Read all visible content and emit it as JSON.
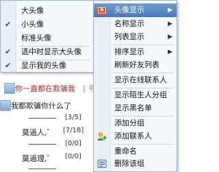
{
  "contacts": {
    "row1_text": "你一直都在欺骗我",
    "row1_suffix": "[ 号",
    "row2_text": "我都欺骗你什么了",
    "sub_rows": [
      {
        "name": "",
        "count": "[3/5]"
      },
      {
        "name": "莫過人,゛",
        "count": "[7/18]"
      },
      {
        "name": "",
        "count": "[0/0]"
      },
      {
        "name": "莫過理,゛",
        "count": "[0/0]"
      }
    ]
  },
  "submenu": {
    "items": [
      {
        "label": "大头像",
        "checked": false
      },
      {
        "label": "小头像",
        "checked": true
      },
      {
        "label": "标准头像",
        "checked": false
      },
      {
        "label": "选中时显示大头像",
        "checked": true
      },
      {
        "label": "显示我的头像",
        "checked": true
      }
    ],
    "check_glyph": "✔"
  },
  "mainmenu": {
    "items": [
      {
        "label": "头像显示",
        "submenu": true,
        "highlighted": true
      },
      {
        "label": "名称显示",
        "submenu": true
      },
      {
        "label": "列表显示",
        "submenu": true
      },
      {
        "label": "排序显示",
        "submenu": true
      },
      {
        "label": "刷新好友列表"
      },
      {
        "label": "显示在线联系人"
      },
      {
        "label": "显示陌生人分组"
      },
      {
        "label": "显示黑名单"
      },
      {
        "label": "添加分组"
      },
      {
        "label": "添加联系人"
      },
      {
        "label": "重命名"
      },
      {
        "label": "删除该组"
      }
    ],
    "arrow_glyph": "▶"
  },
  "colors": {
    "highlight": "#4b79b7",
    "red_text": "#c62020"
  }
}
